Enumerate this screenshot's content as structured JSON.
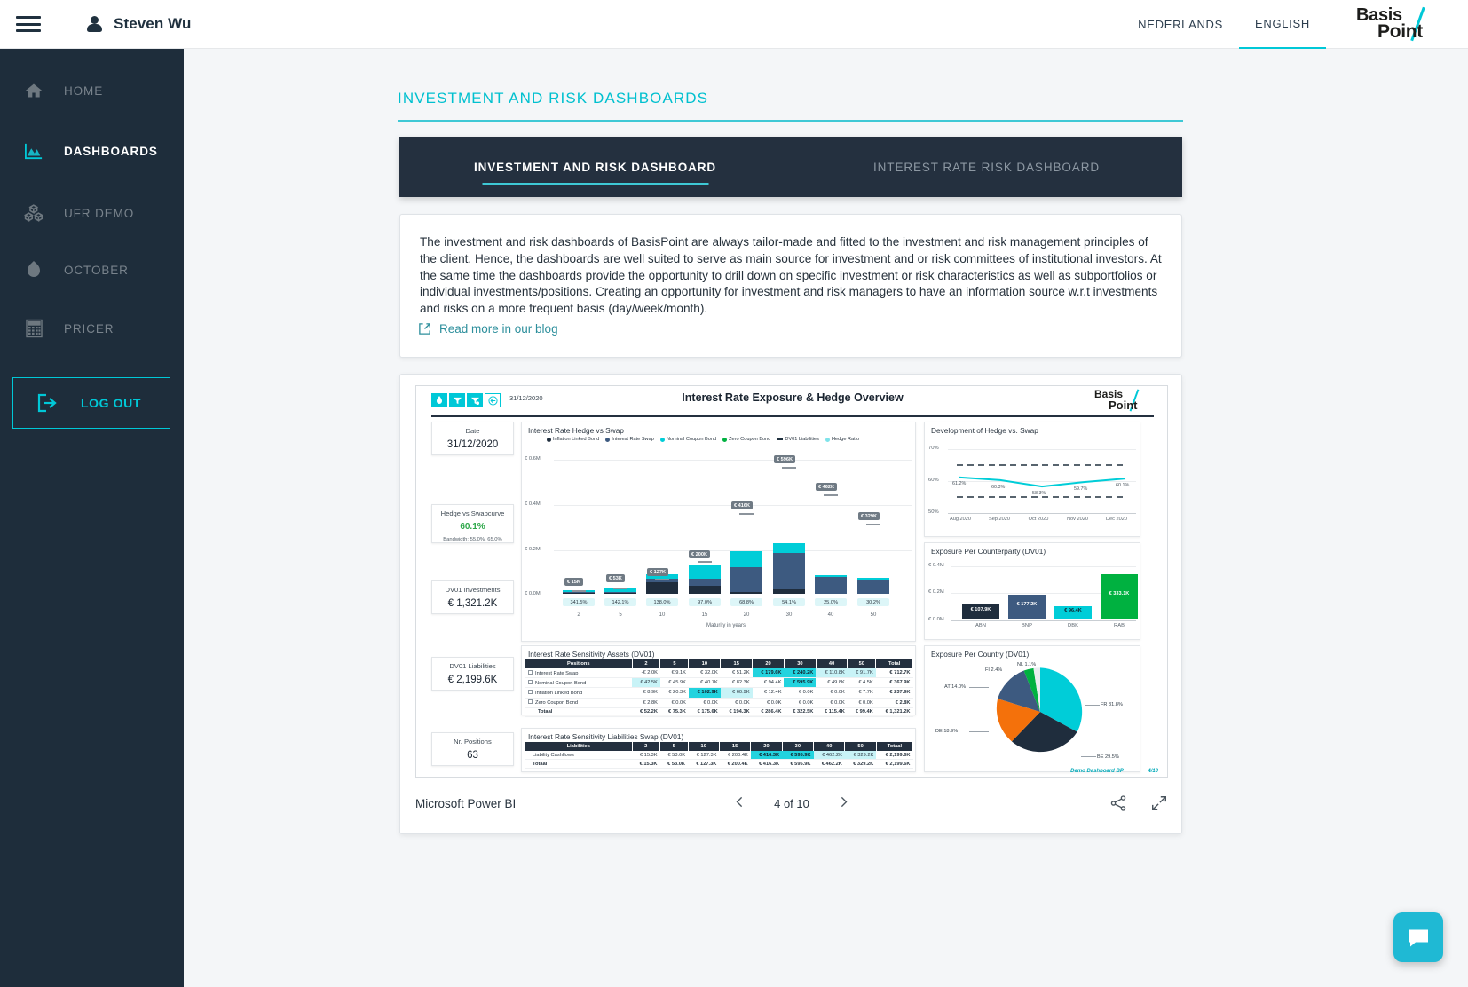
{
  "header": {
    "menu_icon": "hamburger-icon",
    "user_icon": "user-icon",
    "user_name": "Steven Wu",
    "languages": [
      {
        "label": "NEDERLANDS",
        "active": false
      },
      {
        "label": "ENGLISH",
        "active": true
      }
    ],
    "logo": {
      "part1": "Basis",
      "part2": "Point"
    }
  },
  "sidebar": {
    "items": [
      {
        "label": "HOME",
        "icon": "home-icon",
        "active": false
      },
      {
        "label": "DASHBOARDS",
        "icon": "chart-icon",
        "active": true
      },
      {
        "label": "UFR DEMO",
        "icon": "boxes-icon",
        "active": false
      },
      {
        "label": "OCTOBER",
        "icon": "leaf-icon",
        "active": false
      },
      {
        "label": "PRICER",
        "icon": "calculator-icon",
        "active": false
      }
    ],
    "logout": {
      "label": "LOG OUT",
      "icon": "logout-icon"
    }
  },
  "main": {
    "page_title": "INVESTMENT AND RISK DASHBOARDS",
    "tabs": [
      {
        "label": "INVESTMENT AND RISK DASHBOARD",
        "active": true
      },
      {
        "label": "INTEREST RATE RISK DASHBOARD",
        "active": false
      }
    ],
    "info": {
      "body": "The investment and risk dashboards of BasisPoint are always tailor-made and fitted to the investment and risk management principles of the client. Hence, the dashboards are well suited to serve as main source for investment and or risk committees of institutional investors. At the same time the dashboards provide the opportunity to drill down on specific investment or risk characteristics as well as subportfolios or individual investments/positions. Creating an opportunity for investment and risk managers to have an information source w.r.t investments and risks on a more frequent basis (day/week/month).",
      "link_label": "Read more in our blog",
      "link_icon": "external-link-icon"
    }
  },
  "report": {
    "toolbar_buttons": [
      "filter-drop-icon",
      "filter-icon",
      "filter-clear-icon",
      "reset-icon"
    ],
    "date_stamp": "31/12/2020",
    "title": "Interest Rate Exposure & Hedge Overview",
    "logo": {
      "part1": "Basis",
      "part2": "Point"
    },
    "footer_note": "Demo Dashboard BP",
    "page_note": "4/10",
    "footer": {
      "brand": "Microsoft Power BI",
      "prev_icon": "chevron-left-icon",
      "next_icon": "chevron-right-icon",
      "page_label": "4 of 10",
      "share_icon": "share-icon",
      "fullscreen_icon": "fullscreen-icon"
    },
    "kpis": [
      {
        "label": "Date",
        "value": "31/12/2020",
        "sub": ""
      },
      {
        "label": "Hedge vs Swapcurve",
        "value": "60.1%",
        "sub": "Bandwidth: 55.0%, 65.0%",
        "green": true
      },
      {
        "label": "DV01 Investments",
        "value": "€ 1,321.2K",
        "sub": ""
      },
      {
        "label": "DV01 Liabilities",
        "value": "€ 2,199.6K",
        "sub": ""
      },
      {
        "label": "Nr. Positions",
        "value": "63",
        "sub": ""
      }
    ]
  },
  "chart_data": [
    {
      "type": "bar",
      "title": "Interest Rate Hedge vs Swap",
      "xlabel": "Maturity in years",
      "ylabel": "",
      "ylim": [
        0,
        700000
      ],
      "ytick_labels": [
        "€ 0.0M",
        "€ 0.2M",
        "€ 0.4M",
        "€ 0.6M"
      ],
      "ytick_values": [
        0,
        200000,
        400000,
        600000
      ],
      "categories": [
        "2",
        "5",
        "10",
        "15",
        "20",
        "30",
        "40",
        "50"
      ],
      "legend": [
        {
          "name": "Inflation Linked Bond",
          "color": "#1f2d3d",
          "marker": "dot"
        },
        {
          "name": "Interest Rate Swap",
          "color": "#3d5a80",
          "marker": "dot"
        },
        {
          "name": "Nominal Coupon Bond",
          "color": "#00cdd8",
          "marker": "dot"
        },
        {
          "name": "Zero Coupon Bond",
          "color": "#00b140",
          "marker": "dot"
        },
        {
          "name": "DV01 Liabilities",
          "color": "#20313f",
          "marker": "dash"
        },
        {
          "name": "Hedge Ratio",
          "color": "#7fe3ea",
          "marker": "dot"
        }
      ],
      "series": [
        {
          "name": "Inflation Linked Bond",
          "color": "#1f2d3d",
          "values": [
            1000,
            4000,
            52000,
            33000,
            2000,
            17000,
            0,
            0
          ]
        },
        {
          "name": "Interest Rate Swap",
          "color": "#3d5a80",
          "values": [
            2000,
            3000,
            14000,
            31000,
            108000,
            175000,
            26000,
            21000
          ]
        },
        {
          "name": "Nominal Coupon Bond",
          "color": "#00cdd8",
          "values": [
            9000,
            20000,
            20000,
            60000,
            72000,
            44000,
            1500,
            2000
          ]
        },
        {
          "name": "Zero Coupon Bond",
          "color": "#00b140",
          "values": [
            0,
            0,
            0,
            0,
            0,
            0,
            0,
            0
          ]
        }
      ],
      "liability_values": [
        15000,
        53000,
        127000,
        200000,
        416000,
        596000,
        462000,
        329000
      ],
      "liability_callouts": [
        "€ 15K",
        "€ 53K",
        "€ 127K",
        "€ 200K",
        "€ 416K",
        "€ 596K",
        "€ 462K",
        "€ 329K"
      ],
      "hedge_ratio_labels": [
        "341.5%",
        "142.1%",
        "138.0%",
        "97.0%",
        "68.8%",
        "54.1%",
        "25.0%",
        "30.2%"
      ]
    },
    {
      "type": "line",
      "title": "Development of Hedge vs. Swap",
      "ylim": [
        50,
        70
      ],
      "ytick_labels": [
        "50%",
        "60%",
        "70%"
      ],
      "categories": [
        "Aug 2020",
        "Sep 2020",
        "Oct 2020",
        "Nov 2020",
        "Dec 2020"
      ],
      "series": [
        {
          "name": "Hedge vs Swap",
          "color": "#00cdd8",
          "values": [
            61.2,
            60.3,
            58.3,
            59.7,
            60.8
          ]
        }
      ],
      "point_labels": [
        "61.2%",
        "60.3%",
        "58.3%",
        "59.7%",
        "60.1%"
      ],
      "bands": [
        {
          "name": "Upper bandwidth",
          "value": 65.0,
          "style": "dashed",
          "color": "#20313f"
        },
        {
          "name": "Lower bandwidth",
          "value": 55.0,
          "style": "dashed",
          "color": "#20313f"
        }
      ]
    },
    {
      "type": "bar",
      "title": "Exposure Per Counterparty (DV01)",
      "ytick_labels": [
        "€ 0.0M",
        "€ 0.2M",
        "€ 0.4M"
      ],
      "ylim": [
        0,
        400000
      ],
      "categories": [
        "ABN",
        "BNP",
        "DBK",
        "RAB"
      ],
      "values": [
        107900,
        177200,
        96400,
        333100
      ],
      "data_labels": [
        "€ 107.9K",
        "€ 177.2K",
        "€ 96.4K",
        "€ 333.1K"
      ],
      "colors": [
        "#1f2d3d",
        "#3d5a80",
        "#00cdd8",
        "#00b140"
      ]
    },
    {
      "type": "pie",
      "title": "Exposure Per Country (DV01)",
      "labels": [
        "FR",
        "BE",
        "DE",
        "AT",
        "FI",
        "NL"
      ],
      "values": [
        31.8,
        29.5,
        18.9,
        14.0,
        2.4,
        1.1
      ],
      "display_labels": [
        "FR 31.8%",
        "BE 29.5%",
        "DE 18.9%",
        "AT 14.0%",
        "FI 2.4%",
        "NL 1.1%"
      ],
      "colors": [
        "#00cdd8",
        "#1f2d3d",
        "#f4710b",
        "#3d5a80",
        "#00b140",
        "#e9edf0"
      ]
    },
    {
      "type": "table",
      "title": "Interest Rate Sensitivity Assets (DV01)",
      "columns": [
        "Positions",
        "2",
        "5",
        "10",
        "15",
        "20",
        "30",
        "40",
        "50",
        "Total"
      ],
      "rows": [
        {
          "label": "Interest Rate Swap",
          "cells": [
            "-€ 2.0K",
            "€ 9.1K",
            "€ 32.0K",
            "€ 51.2K",
            "€ 179.6K",
            "€ 240.2K",
            "€ 110.8K",
            "€ 91.7K",
            "€ 712.7K"
          ],
          "hl": [
            0,
            0,
            0,
            0,
            2,
            2,
            1,
            1,
            0
          ]
        },
        {
          "label": "Nominal Coupon Bond",
          "cells": [
            "€ 42.5K",
            "€ 45.9K",
            "€ 40.7K",
            "€ 82.3K",
            "€ 94.4K",
            "€ 595.9K",
            "€ 49.8K",
            "€ 4.5K",
            "€ 367.9K"
          ],
          "hl": [
            1,
            0,
            0,
            0,
            0,
            2,
            0,
            0,
            0
          ]
        },
        {
          "label": "Inflation Linked Bond",
          "cells": [
            "€ 8.9K",
            "€ 20.3K",
            "€ 102.9K",
            "€ 60.9K",
            "€ 12.4K",
            "€ 0.0K",
            "€ 0.0K",
            "€ 7.7K",
            "€ 237.9K"
          ],
          "hl": [
            0,
            0,
            2,
            1,
            0,
            0,
            0,
            0,
            0
          ]
        },
        {
          "label": "Zero Coupon Bond",
          "cells": [
            "€ 2.8K",
            "€ 0.0K",
            "€ 0.0K",
            "€ 0.0K",
            "€ 0.0K",
            "€ 0.0K",
            "€ 0.0K",
            "€ 0.0K",
            "€ 2.8K"
          ],
          "hl": [
            0,
            0,
            0,
            0,
            0,
            0,
            0,
            0,
            0
          ]
        }
      ],
      "total_row": {
        "label": "Totaal",
        "cells": [
          "€ 52.2K",
          "€ 75.3K",
          "€ 175.6K",
          "€ 194.3K",
          "€ 286.4K",
          "€ 322.5K",
          "€ 115.4K",
          "€ 99.4K",
          "€ 1,321.2K"
        ]
      }
    },
    {
      "type": "table",
      "title": "Interest Rate Sensitivity Liabilities Swap (DV01)",
      "columns": [
        "Liabilities",
        "2",
        "5",
        "10",
        "15",
        "20",
        "30",
        "40",
        "50",
        "Totaal"
      ],
      "rows": [
        {
          "label": "Liability Cashflows",
          "cells": [
            "€ 15.3K",
            "€ 53.0K",
            "€ 127.3K",
            "€ 200.4K",
            "€ 416.3K",
            "€ 595.9K",
            "€ 462.2K",
            "€ 329.2K",
            "€ 2,199.6K"
          ],
          "hl": [
            0,
            0,
            0,
            0,
            2,
            2,
            1,
            1,
            0
          ]
        }
      ],
      "total_row": {
        "label": "Totaal",
        "cells": [
          "€ 15.3K",
          "€ 53.0K",
          "€ 127.3K",
          "€ 200.4K",
          "€ 416.3K",
          "€ 595.9K",
          "€ 462.2K",
          "€ 329.2K",
          "€ 2,199.6K"
        ]
      }
    }
  ],
  "chat": {
    "icon": "chat-icon",
    "color": "#1fb9d4"
  }
}
